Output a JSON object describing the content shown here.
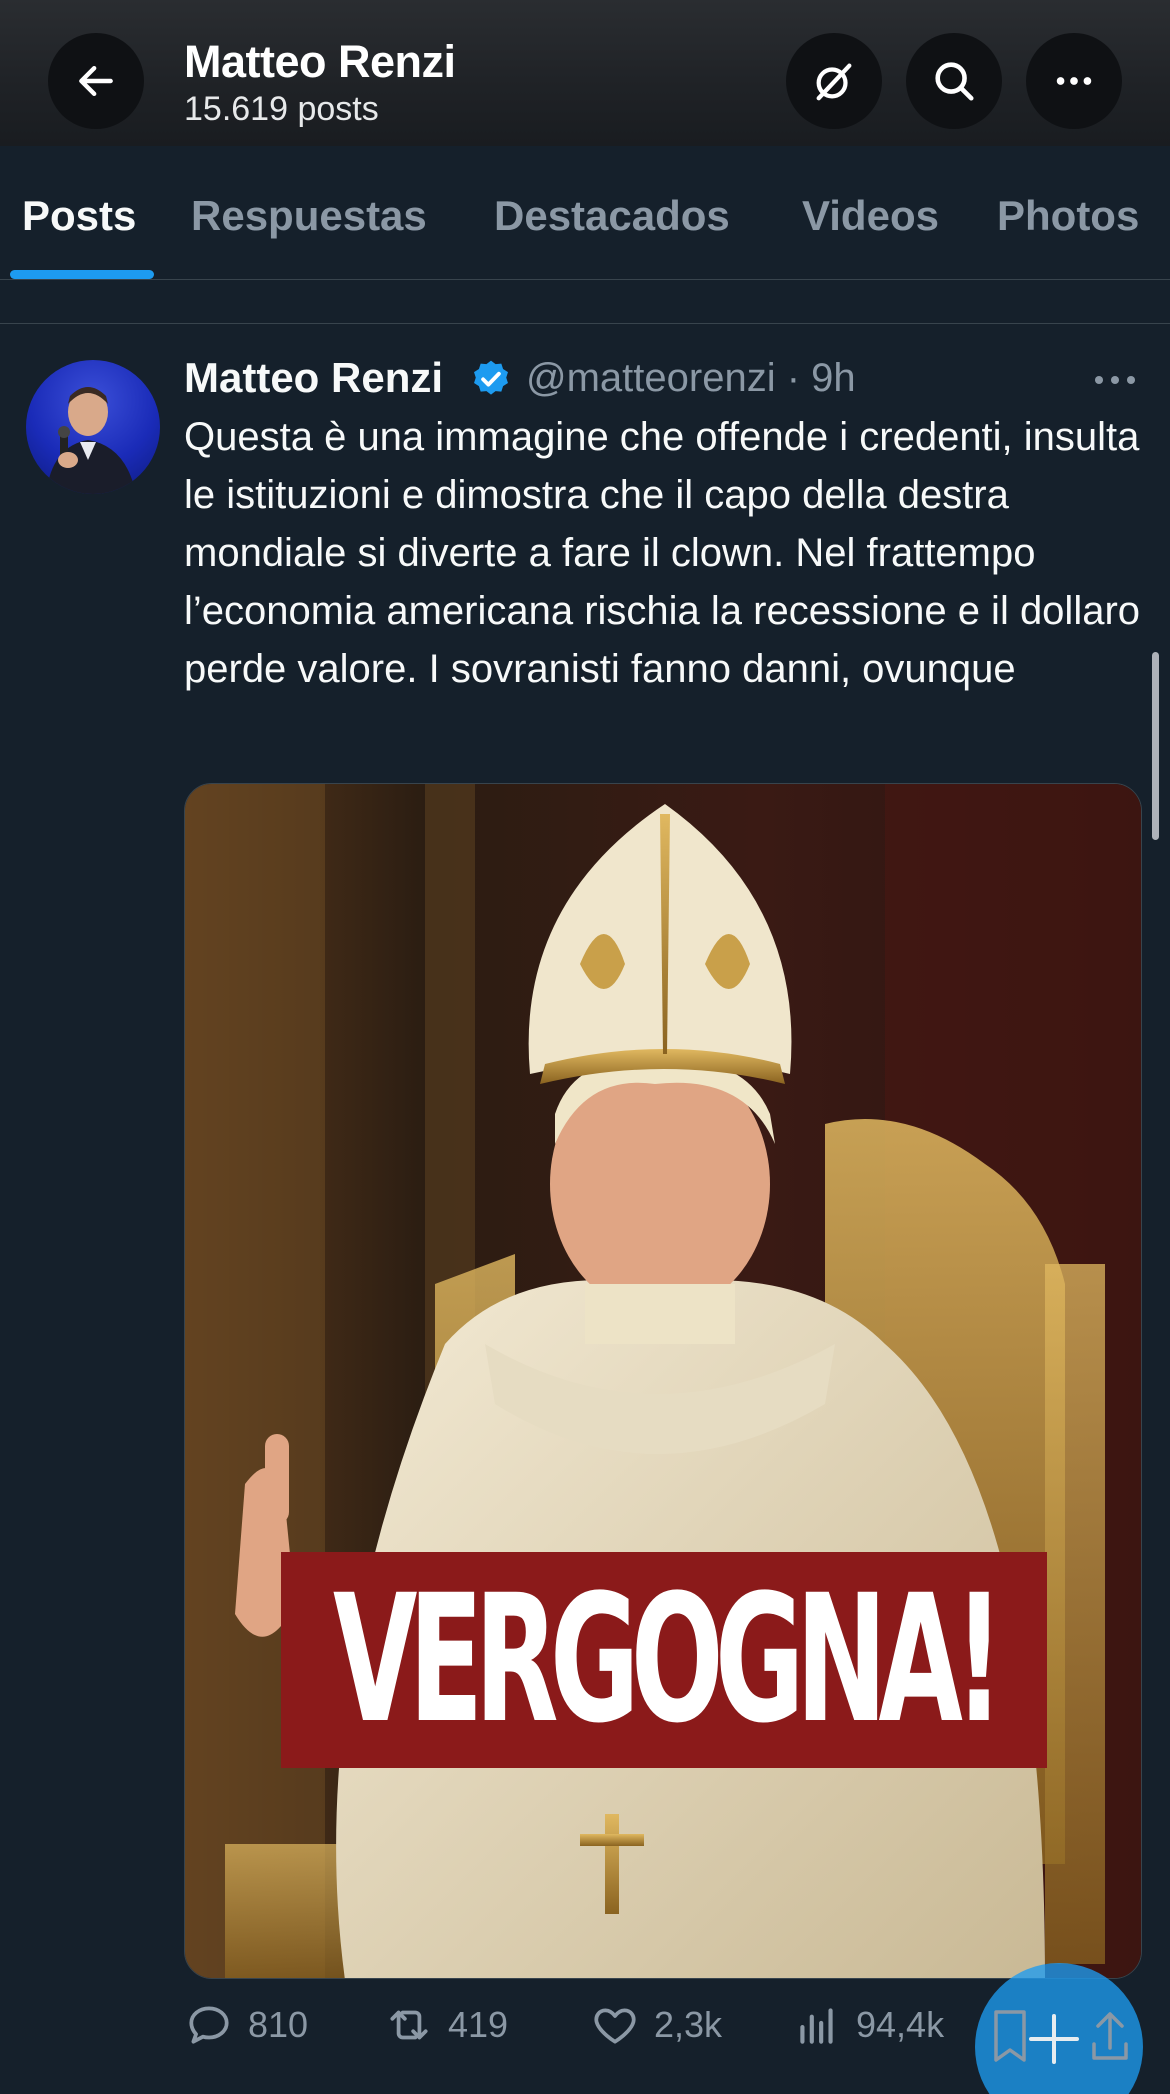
{
  "header": {
    "title": "Matteo Renzi",
    "subtitle": "15.619 posts"
  },
  "tabs": [
    {
      "label": "Posts",
      "active": true
    },
    {
      "label": "Respuestas",
      "active": false
    },
    {
      "label": "Destacados",
      "active": false
    },
    {
      "label": "Videos",
      "active": false
    },
    {
      "label": "Photos",
      "active": false
    }
  ],
  "post": {
    "author": "Matteo Renzi",
    "handle": "@matteorenzi",
    "time": "9h",
    "handle_time": "@matteorenzi · 9h",
    "text": "Questa è una immagine che offende i credenti, insulta le istituzioni e dimostra che il capo della destra mondiale si diverte a fare il clown. Nel frattempo l’economia americana rischia la recessione e il dollaro perde valore. I sovranisti fanno danni, ovunque",
    "image_banner": "VERGOGNA!",
    "stats": {
      "replies": "810",
      "reposts": "419",
      "likes": "2,3k",
      "views": "94,4k"
    }
  },
  "colors": {
    "background": "#15202b",
    "accent": "#1d9bf0",
    "muted_text": "#8b98a5",
    "banner_red": "#8b1a1a"
  },
  "icons": [
    "back-arrow-icon",
    "grok-icon",
    "search-icon",
    "more-icon",
    "verified-badge-icon",
    "reply-icon",
    "repost-icon",
    "like-icon",
    "views-icon",
    "bookmark-icon",
    "compose-plus-icon",
    "share-icon"
  ]
}
